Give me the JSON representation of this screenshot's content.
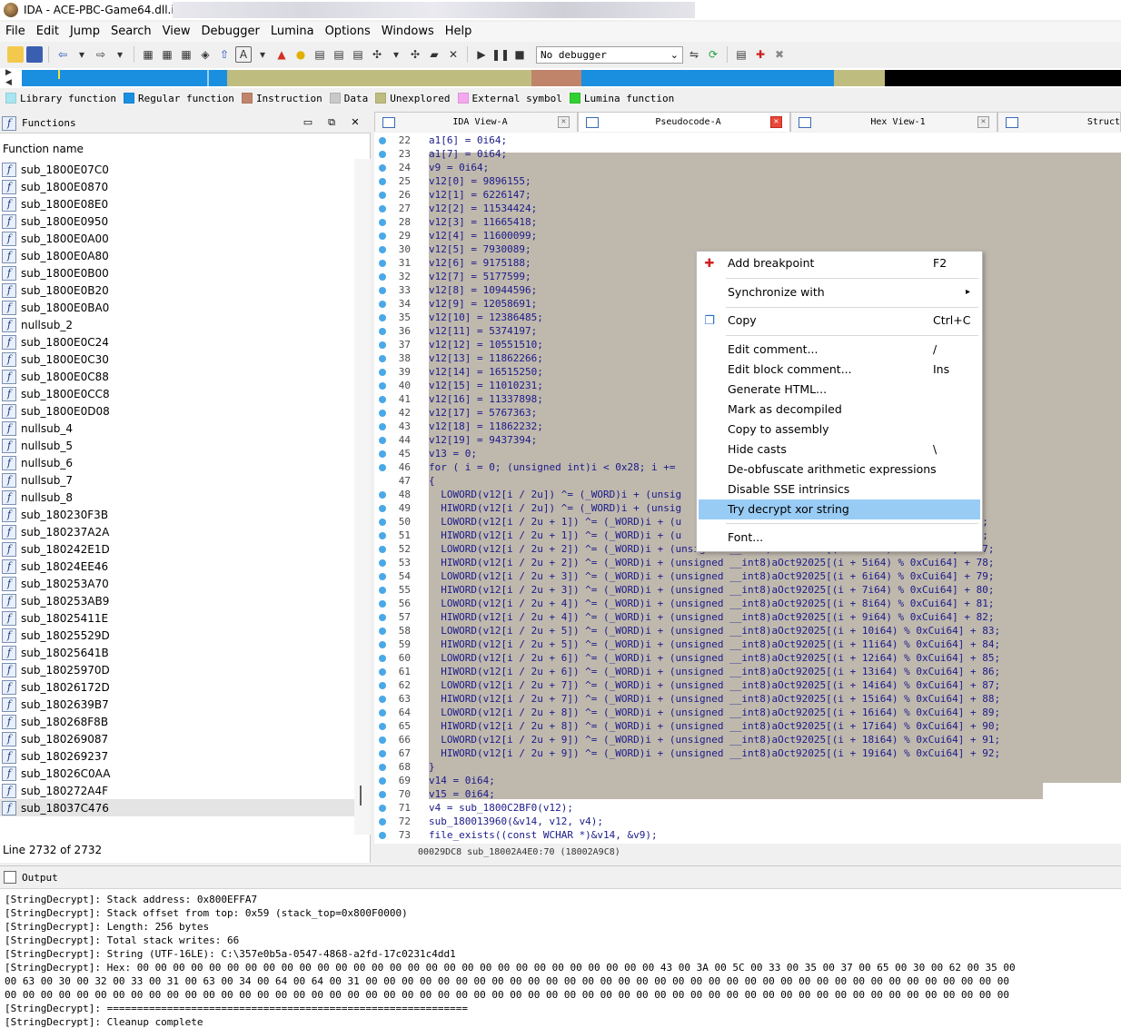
{
  "window": {
    "title": "IDA - ACE-PBC-Game64.dll.i64"
  },
  "menu": [
    "File",
    "Edit",
    "Jump",
    "Search",
    "View",
    "Debugger",
    "Lumina",
    "Options",
    "Windows",
    "Help"
  ],
  "toolbar": {
    "debugger_select": "No debugger"
  },
  "legend": [
    {
      "label": "Library function",
      "color": "#a7e5f0"
    },
    {
      "label": "Regular function",
      "color": "#1a8fe0"
    },
    {
      "label": "Instruction",
      "color": "#c0846a"
    },
    {
      "label": "Data",
      "color": "#c8c8c8"
    },
    {
      "label": "Unexplored",
      "color": "#bfbc80"
    },
    {
      "label": "External symbol",
      "color": "#f5a8f0"
    },
    {
      "label": "Lumina function",
      "color": "#30d030"
    }
  ],
  "functions": {
    "title": "Functions",
    "column": "Function name",
    "items": [
      "sub_1800E07C0",
      "sub_1800E0870",
      "sub_1800E08E0",
      "sub_1800E0950",
      "sub_1800E0A00",
      "sub_1800E0A80",
      "sub_1800E0B00",
      "sub_1800E0B20",
      "sub_1800E0BA0",
      "nullsub_2",
      "sub_1800E0C24",
      "sub_1800E0C30",
      "sub_1800E0C88",
      "sub_1800E0CC8",
      "sub_1800E0D08",
      "nullsub_4",
      "nullsub_5",
      "nullsub_6",
      "nullsub_7",
      "nullsub_8",
      "sub_180230F3B",
      "sub_180237A2A",
      "sub_180242E1D",
      "sub_18024EE46",
      "sub_180253A70",
      "sub_180253AB9",
      "sub_18025411E",
      "sub_18025529D",
      "sub_18025641B",
      "sub_18025970D",
      "sub_18026172D",
      "sub_1802639B7",
      "sub_180268F8B",
      "sub_180269087",
      "sub_180269237",
      "sub_18026C0AA",
      "sub_180272A4F",
      "sub_18037C476"
    ],
    "selected": "sub_18037C476",
    "status": "Line 2732 of 2732"
  },
  "tabs": [
    {
      "label": "IDA View-A",
      "active": false
    },
    {
      "label": "Pseudocode-A",
      "active": true
    },
    {
      "label": "Hex View-1",
      "active": false
    },
    {
      "label": "Struct",
      "active": false
    }
  ],
  "code": {
    "lines": [
      {
        "n": "22",
        "t": "a1[6] = 0i64;"
      },
      {
        "n": "23",
        "t": "a1[7] = 0i64;"
      },
      {
        "n": "24",
        "t": "v9 = 0i64;"
      },
      {
        "n": "25",
        "t": "v12[0] = 9896155;"
      },
      {
        "n": "26",
        "t": "v12[1] = 6226147;"
      },
      {
        "n": "27",
        "t": "v12[2] = 11534424;"
      },
      {
        "n": "28",
        "t": "v12[3] = 11665418;"
      },
      {
        "n": "29",
        "t": "v12[4] = 11600099;"
      },
      {
        "n": "30",
        "t": "v12[5] = 7930089;"
      },
      {
        "n": "31",
        "t": "v12[6] = 9175188;"
      },
      {
        "n": "32",
        "t": "v12[7] = 5177599;"
      },
      {
        "n": "33",
        "t": "v12[8] = 10944596;"
      },
      {
        "n": "34",
        "t": "v12[9] = 12058691;"
      },
      {
        "n": "35",
        "t": "v12[10] = 12386485;"
      },
      {
        "n": "36",
        "t": "v12[11] = 5374197;"
      },
      {
        "n": "37",
        "t": "v12[12] = 10551510;"
      },
      {
        "n": "38",
        "t": "v12[13] = 11862266;"
      },
      {
        "n": "39",
        "t": "v12[14] = 16515250;"
      },
      {
        "n": "40",
        "t": "v12[15] = 11010231;"
      },
      {
        "n": "41",
        "t": "v12[16] = 11337898;"
      },
      {
        "n": "42",
        "t": "v12[17] = 5767363;"
      },
      {
        "n": "43",
        "t": "v12[18] = 11862232;"
      },
      {
        "n": "44",
        "t": "v12[19] = 9437394;"
      },
      {
        "n": "45",
        "t": "v13 = 0;"
      },
      {
        "n": "46",
        "t": "for ( i = 0; (unsigned int)i < 0x28; i +="
      },
      {
        "n": "47",
        "t": "{"
      },
      {
        "n": "48",
        "t": "  LOWORD(v12[i / 2u]) ^= (_WORD)i + (unsig"
      },
      {
        "n": "49",
        "t": "  HIWORD(v12[i / 2u]) ^= (_WORD)i + (unsig                                              74;"
      },
      {
        "n": "50",
        "t": "  LOWORD(v12[i / 2u + 1]) ^= (_WORD)i + (u                                            ] + 75;"
      },
      {
        "n": "51",
        "t": "  HIWORD(v12[i / 2u + 1]) ^= (_WORD)i + (u                                            ] + 76;"
      },
      {
        "n": "52",
        "t": "  LOWORD(v12[i / 2u + 2]) ^= (_WORD)i + (unsigned __int8)aOct92025[(i + 4164) % 0xCui64] + 77;"
      },
      {
        "n": "53",
        "t": "  HIWORD(v12[i / 2u + 2]) ^= (_WORD)i + (unsigned __int8)aOct92025[(i + 5i64) % 0xCui64] + 78;"
      },
      {
        "n": "54",
        "t": "  LOWORD(v12[i / 2u + 3]) ^= (_WORD)i + (unsigned __int8)aOct92025[(i + 6i64) % 0xCui64] + 79;"
      },
      {
        "n": "55",
        "t": "  HIWORD(v12[i / 2u + 3]) ^= (_WORD)i + (unsigned __int8)aOct92025[(i + 7i64) % 0xCui64] + 80;"
      },
      {
        "n": "56",
        "t": "  LOWORD(v12[i / 2u + 4]) ^= (_WORD)i + (unsigned __int8)aOct92025[(i + 8i64) % 0xCui64] + 81;"
      },
      {
        "n": "57",
        "t": "  HIWORD(v12[i / 2u + 4]) ^= (_WORD)i + (unsigned __int8)aOct92025[(i + 9i64) % 0xCui64] + 82;"
      },
      {
        "n": "58",
        "t": "  LOWORD(v12[i / 2u + 5]) ^= (_WORD)i + (unsigned __int8)aOct92025[(i + 10i64) % 0xCui64] + 83;"
      },
      {
        "n": "59",
        "t": "  HIWORD(v12[i / 2u + 5]) ^= (_WORD)i + (unsigned __int8)aOct92025[(i + 11i64) % 0xCui64] + 84;"
      },
      {
        "n": "60",
        "t": "  LOWORD(v12[i / 2u + 6]) ^= (_WORD)i + (unsigned __int8)aOct92025[(i + 12i64) % 0xCui64] + 85;"
      },
      {
        "n": "61",
        "t": "  HIWORD(v12[i / 2u + 6]) ^= (_WORD)i + (unsigned __int8)aOct92025[(i + 13i64) % 0xCui64] + 86;"
      },
      {
        "n": "62",
        "t": "  LOWORD(v12[i / 2u + 7]) ^= (_WORD)i + (unsigned __int8)aOct92025[(i + 14i64) % 0xCui64] + 87;"
      },
      {
        "n": "63",
        "t": "  HIWORD(v12[i / 2u + 7]) ^= (_WORD)i + (unsigned __int8)aOct92025[(i + 15i64) % 0xCui64] + 88;"
      },
      {
        "n": "64",
        "t": "  LOWORD(v12[i / 2u + 8]) ^= (_WORD)i + (unsigned __int8)aOct92025[(i + 16i64) % 0xCui64] + 89;"
      },
      {
        "n": "65",
        "t": "  HIWORD(v12[i / 2u + 8]) ^= (_WORD)i + (unsigned __int8)aOct92025[(i + 17i64) % 0xCui64] + 90;"
      },
      {
        "n": "66",
        "t": "  LOWORD(v12[i / 2u + 9]) ^= (_WORD)i + (unsigned __int8)aOct92025[(i + 18i64) % 0xCui64] + 91;"
      },
      {
        "n": "67",
        "t": "  HIWORD(v12[i / 2u + 9]) ^= (_WORD)i + (unsigned __int8)aOct92025[(i + 19i64) % 0xCui64] + 92;"
      },
      {
        "n": "68",
        "t": "}"
      },
      {
        "n": "69",
        "t": "v14 = 0i64;"
      },
      {
        "n": "70",
        "t": "v15 = 0i64;"
      },
      {
        "n": "71",
        "t": "v4 = sub_1800C2BF0(v12);"
      },
      {
        "n": "72",
        "t": "sub_180013960(&v14, v12, v4);"
      },
      {
        "n": "73",
        "t": "file_exists((const WCHAR *)&v14, &v9);"
      }
    ],
    "status": "00029DC8 sub_18002A4E0:70 (18002A9C8)"
  },
  "context_menu": {
    "items": [
      {
        "label": "Add breakpoint",
        "shortcut": "F2"
      },
      {
        "label": "Synchronize with",
        "shortcut": "▸"
      },
      {
        "label": "Copy",
        "shortcut": "Ctrl+C"
      },
      {
        "label": "Edit comment...",
        "shortcut": "/"
      },
      {
        "label": "Edit block comment...",
        "shortcut": "Ins"
      },
      {
        "label": "Generate HTML...",
        "shortcut": ""
      },
      {
        "label": "Mark as decompiled",
        "shortcut": ""
      },
      {
        "label": "Copy to assembly",
        "shortcut": ""
      },
      {
        "label": "Hide casts",
        "shortcut": "\\"
      },
      {
        "label": "De-obfuscate arithmetic expressions",
        "shortcut": ""
      },
      {
        "label": "Disable SSE intrinsics",
        "shortcut": ""
      },
      {
        "label": "Try decrypt xor string",
        "shortcut": ""
      },
      {
        "label": "Font...",
        "shortcut": ""
      }
    ],
    "highlighted": "Try decrypt xor string"
  },
  "output": {
    "title": "Output",
    "lines": [
      "[StringDecrypt]: Stack address: 0x800EFFA7",
      "[StringDecrypt]: Stack offset from top: 0x59 (stack_top=0x800F0000)",
      "[StringDecrypt]: Length: 256 bytes",
      "[StringDecrypt]: Total stack writes: 66",
      "[StringDecrypt]: String (UTF-16LE): C:\\357e0b5a-0547-4868-a2fd-17c0231c4dd1",
      "[StringDecrypt]: Hex: 00 00 00 00 00 00 00 00 00 00 00 00 00 00 00 00 00 00 00 00 00 00 00 00 00 00 00 00 00 43 00 3A 00 5C 00 33 00 35 00 37 00 65 00 30 00 62 00 35 00",
      "00 63 00 30 00 32 00 33 00 31 00 63 00 34 00 64 00 64 00 31 00 00 00 00 00 00 00 00 00 00 00 00 00 00 00 00 00 00 00 00 00 00 00 00 00 00 00 00 00 00 00 00 00 00 00 00",
      "00 00 00 00 00 00 00 00 00 00 00 00 00 00 00 00 00 00 00 00 00 00 00 00 00 00 00 00 00 00 00 00 00 00 00 00 00 00 00 00 00 00 00 00 00 00 00 00 00 00 00 00 00 00 00 00",
      "[StringDecrypt]: ============================================================",
      "[StringDecrypt]: Cleanup complete"
    ]
  }
}
